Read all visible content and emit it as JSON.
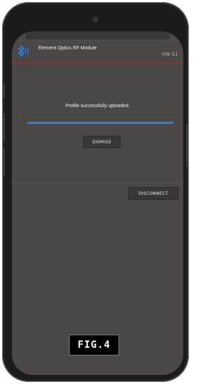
{
  "app": {
    "title": "Element Optics RF Module",
    "firmware": "F/W: 3.1"
  },
  "upload": {
    "status_text": "Profile successfully uploaded.",
    "progress_fraction": 1.0
  },
  "buttons": {
    "dismiss_label": "DISMISS",
    "disconnect_label": "DISCONNECT"
  },
  "figure": {
    "label": "FIG.4"
  },
  "colors": {
    "screen_bg": "#4b4746",
    "accent_blue": "#2f80d6",
    "divider_red": "#8a3a37"
  },
  "icons": {
    "bluetooth": "bluetooth-icon"
  }
}
